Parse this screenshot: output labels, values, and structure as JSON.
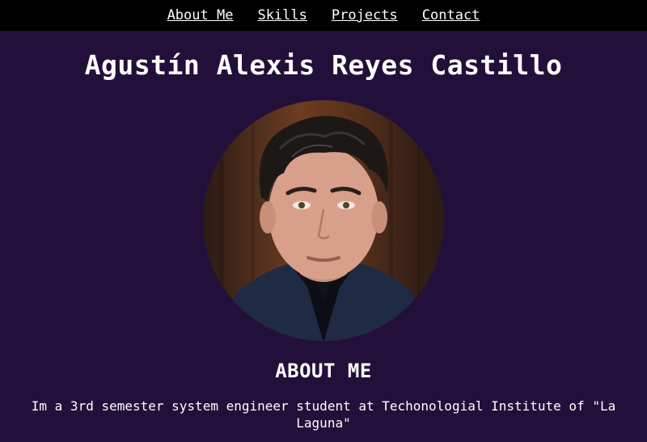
{
  "nav": {
    "items": [
      {
        "label": "About Me"
      },
      {
        "label": "Skills"
      },
      {
        "label": "Projects"
      },
      {
        "label": "Contact"
      }
    ]
  },
  "header": {
    "name": "Agustín Alexis Reyes Castillo"
  },
  "profile": {
    "photo_icon": "profile-photo"
  },
  "about": {
    "title": "ABOUT ME",
    "text": "Im a 3rd semester system engineer student at Techonologial Institute of \"La Laguna\""
  },
  "colors": {
    "background": "#22103a",
    "navbar": "#000000",
    "text": "#ffffff"
  }
}
